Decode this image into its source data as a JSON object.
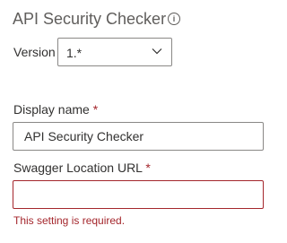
{
  "header": {
    "title": "API Security Checker",
    "info_icon": "info-icon",
    "info_glyph": "i"
  },
  "version": {
    "label": "Version",
    "value": "1.*",
    "icon": "chevron-down-icon"
  },
  "fields": {
    "display_name": {
      "label": "Display name",
      "required_mark": "*",
      "value": "API Security Checker"
    },
    "swagger_url": {
      "label": "Swagger Location URL",
      "required_mark": "*",
      "value": "",
      "error": "This setting is required."
    }
  },
  "colors": {
    "error": "#a4262c",
    "border": "#8a8886",
    "text": "#323130",
    "muted_text": "#605e5c"
  }
}
